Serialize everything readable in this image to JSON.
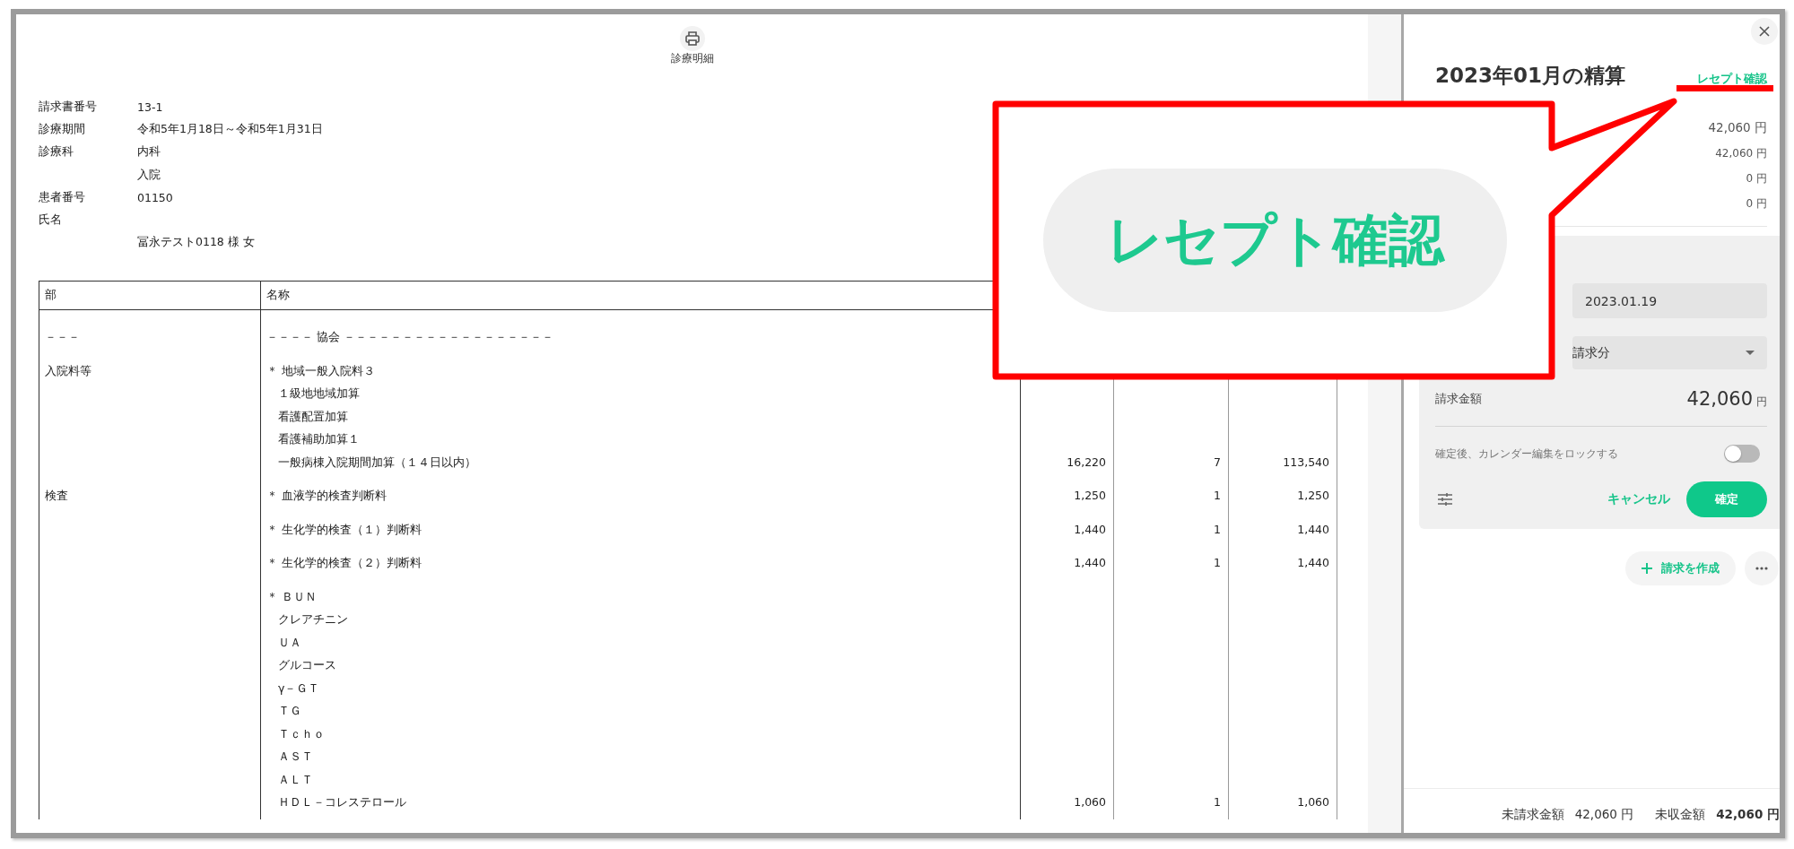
{
  "document": {
    "print_label": "診療明細",
    "info": [
      {
        "label": "請求書番号",
        "value": "13-1"
      },
      {
        "label": "診療期間",
        "value": "令和5年1月18日～令和5年1月31日"
      },
      {
        "label": "診療科",
        "value": "内科"
      },
      {
        "value": "入院"
      },
      {
        "label": "患者番号",
        "value": "01150"
      },
      {
        "label": "氏名"
      },
      {
        "value": "冨永テスト0118 様 女"
      }
    ],
    "table": {
      "columns": [
        "部",
        "名称"
      ],
      "rows": [
        {
          "section": "－－－",
          "lines": [
            "－－－－ 協会 －－－－－－－－－－－－－－－－－－"
          ]
        },
        {
          "section": "入院料等",
          "lines": [
            "＊ 地域一般入院料３",
            "　１級地地域加算",
            "　看護配置加算",
            "　看護補助加算１",
            "　一般病棟入院期間加算（１４日以内）"
          ],
          "column_3": "16,220",
          "column_4": "7",
          "column_5": "113,540"
        },
        {
          "section": "検査",
          "lines": [
            "＊ 血液学的検査判断料"
          ],
          "column_3": "1,250",
          "column_4": "1",
          "column_5": "1,250"
        },
        {
          "lines": [
            "＊ 生化学的検査（１）判断料"
          ],
          "column_3": "1,440",
          "column_4": "1",
          "column_5": "1,440"
        },
        {
          "lines": [
            "＊ 生化学的検査（２）判断料"
          ],
          "column_3": "1,440",
          "column_4": "1",
          "column_5": "1,440"
        },
        {
          "lines": [
            "＊ ＢＵＮ",
            "　クレアチニン",
            "　ＵＡ",
            "　グルコース",
            "　γ－ＧＴ",
            "　ＴＧ",
            "　Ｔｃｈｏ",
            "　ＡＳＴ",
            "　ＡＬＴ",
            "　ＨＤＬ－コレステロール"
          ],
          "column_3": "1,060",
          "column_4": "1",
          "column_5": "1,060"
        }
      ]
    }
  },
  "settlement": {
    "title": "2023年01月の精算",
    "receipt_link": "レセプト確認",
    "amounts": [
      {
        "kind": "total",
        "value": "42,060 円"
      },
      {
        "kind": "detail",
        "value": "42,060 円"
      },
      {
        "kind": "detail",
        "value": "0 円"
      },
      {
        "kind": "detail",
        "value": "0 円"
      }
    ],
    "date": "2023.01.19",
    "billing_type": "請求分",
    "billing_amount_label": "請求金額",
    "billing_amount": "42,060",
    "billing_unit": "円",
    "lock": {
      "label": "確定後、カレンダー編集をロックする",
      "on": false
    },
    "cancel": "キャンセル",
    "confirm": "確定",
    "create": "請求を作成",
    "footer": [
      {
        "label": "未請求金額",
        "value": "42,060 円",
        "emphasis": false
      },
      {
        "label": "未収金額",
        "value": "42,060 円",
        "emphasis": true
      }
    ]
  },
  "annotation": {
    "callout_text": "レセプト確認"
  }
}
